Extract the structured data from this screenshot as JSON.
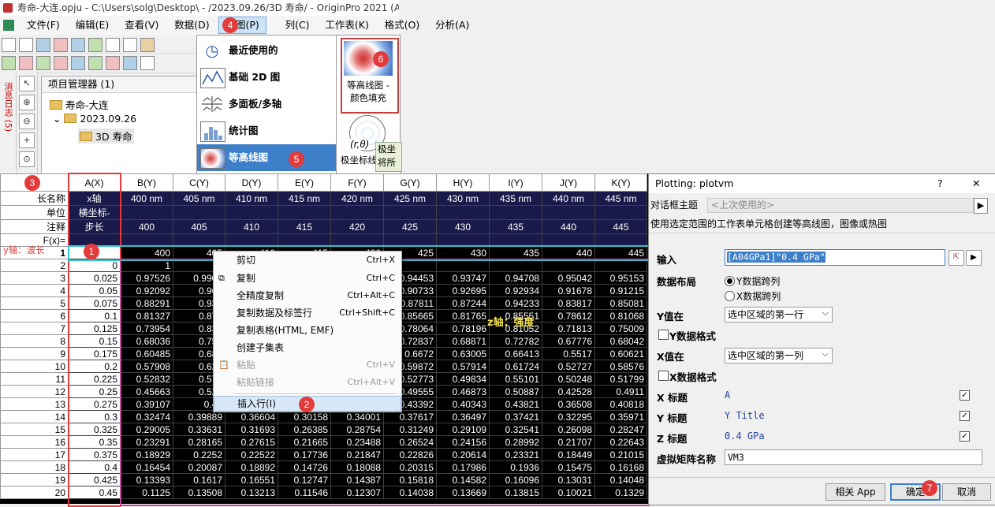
{
  "window": {
    "title": "寿命-大连.opju - C:\\Users\\solg\\Desktop\\ - /2023.09.26/3D 寿命/ - OriginPro 2021 (A"
  },
  "menubar": [
    "文件(F)",
    "编辑(E)",
    "查看(V)",
    "数据(D)",
    "绘图(P)",
    "列(C)",
    "工作表(K)",
    "格式(O)",
    "分析(A)"
  ],
  "side_label": "消息日志 (5)",
  "project_manager": {
    "title": "项目管理器 (1)",
    "root": "寿命-大连",
    "folder": "2023.09.26",
    "subfolder": "3D 寿命"
  },
  "plot_menu": {
    "items": [
      "最近使用的",
      "基础 2D 图",
      "多面板/多轴",
      "统计图",
      "等高线图"
    ],
    "selected": "等高线图",
    "contour_fill_label": "等高线图 - 颜色填充",
    "polar_label": "极坐标线图",
    "polar_formula": "(r,θ)",
    "polar_tip": "极坐 将所"
  },
  "worksheet": {
    "corner_badge": "3",
    "columns": [
      "A(X)",
      "B(Y)",
      "C(Y)",
      "D(Y)",
      "E(Y)",
      "F(Y)",
      "G(Y)",
      "H(Y)",
      "I(Y)",
      "J(Y)",
      "K(Y)"
    ],
    "row_labels": {
      "long_name": "长名称",
      "units": "单位",
      "comments": "注释",
      "fx": "F(x)="
    },
    "long_names": [
      "x轴",
      "400 nm",
      "405 nm",
      "410 nm",
      "415 nm",
      "420 nm",
      "425 nm",
      "430 nm",
      "435 nm",
      "440 nm",
      "445 nm"
    ],
    "units": [
      "横坐标-",
      "",
      "",
      "",
      "",
      "",
      "",
      "",
      "",
      "",
      ""
    ],
    "comments": [
      "步长",
      "400",
      "405",
      "410",
      "415",
      "420",
      "425",
      "430",
      "435",
      "440",
      "445"
    ],
    "y_axis_note": "y轴：波长",
    "z_axis_note": "z轴：强度",
    "rows": [
      {
        "n": "1",
        "cells": [
          "",
          "400",
          "405",
          "410",
          "415",
          "420",
          "425",
          "430",
          "435",
          "440",
          "445"
        ]
      },
      {
        "n": "2",
        "cells": [
          "0",
          "1",
          "",
          "",
          "",
          "",
          "",
          "",
          "",
          "",
          ""
        ]
      },
      {
        "n": "3",
        "cells": [
          "0.025",
          "0.97526",
          "0.9909",
          "",
          "",
          "",
          "0.94453",
          "0.93747",
          "0.94708",
          "0.95042",
          "0.95153"
        ]
      },
      {
        "n": "4",
        "cells": [
          "0.05",
          "0.92092",
          "0.965",
          "",
          "",
          "",
          "0.90733",
          "0.92695",
          "0.92934",
          "0.91678",
          "0.91215"
        ]
      },
      {
        "n": "5",
        "cells": [
          "0.075",
          "0.88291",
          "0.937",
          "",
          "",
          "",
          "0.87811",
          "0.87244",
          "0.94233",
          "0.83817",
          "0.85081"
        ]
      },
      {
        "n": "6",
        "cells": [
          "0.1",
          "0.81327",
          "0.879",
          "",
          "",
          "",
          "0.85665",
          "0.81765",
          "0.85551",
          "0.78612",
          "0.81068"
        ]
      },
      {
        "n": "7",
        "cells": [
          "0.125",
          "0.73954",
          "0.831",
          "",
          "",
          "",
          "0.78064",
          "0.78196",
          "0.81052",
          "0.71813",
          "0.75009"
        ]
      },
      {
        "n": "8",
        "cells": [
          "0.15",
          "0.68036",
          "0.758",
          "",
          "",
          "",
          "0.72837",
          "0.68871",
          "0.72782",
          "0.67776",
          "0.68042"
        ]
      },
      {
        "n": "9",
        "cells": [
          "0.175",
          "0.60485",
          "0.683",
          "",
          "",
          "",
          "0.6672",
          "0.63005",
          "0.66413",
          "0.5517",
          "0.60621"
        ]
      },
      {
        "n": "10",
        "cells": [
          "0.2",
          "0.57908",
          "0.629",
          "",
          "",
          "",
          "0.59872",
          "0.57914",
          "0.61724",
          "0.52727",
          "0.58576"
        ]
      },
      {
        "n": "11",
        "cells": [
          "0.225",
          "0.52832",
          "0.572",
          "",
          "",
          "",
          "0.52773",
          "0.49834",
          "0.55101",
          "0.50248",
          "0.51799"
        ]
      },
      {
        "n": "12",
        "cells": [
          "0.25",
          "0.45663",
          "0.524",
          "",
          "",
          "",
          "0.49555",
          "0.46873",
          "0.50887",
          "0.42528",
          "0.4911"
        ]
      },
      {
        "n": "13",
        "cells": [
          "0.275",
          "0.39107",
          "0.46",
          "",
          "",
          "",
          "0.43392",
          "0.40343",
          "0.43821",
          "0.36508",
          "0.40818"
        ]
      },
      {
        "n": "14",
        "cells": [
          "0.3",
          "0.32474",
          "0.39889",
          "0.36604",
          "0.30158",
          "0.34001",
          "0.37617",
          "0.36497",
          "0.37421",
          "0.32295",
          "0.35971"
        ]
      },
      {
        "n": "15",
        "cells": [
          "0.325",
          "0.29005",
          "0.33631",
          "0.31693",
          "0.26385",
          "0.28754",
          "0.31249",
          "0.29109",
          "0.32541",
          "0.26098",
          "0.28247"
        ]
      },
      {
        "n": "16",
        "cells": [
          "0.35",
          "0.23291",
          "0.28165",
          "0.27615",
          "0.21665",
          "0.23488",
          "0.26524",
          "0.24156",
          "0.28992",
          "0.21707",
          "0.22643"
        ]
      },
      {
        "n": "17",
        "cells": [
          "0.375",
          "0.18929",
          "0.2252",
          "0.22522",
          "0.17736",
          "0.21847",
          "0.22826",
          "0.20614",
          "0.23321",
          "0.18449",
          "0.21015"
        ]
      },
      {
        "n": "18",
        "cells": [
          "0.4",
          "0.16454",
          "0.20087",
          "0.18892",
          "0.14726",
          "0.18088",
          "0.20315",
          "0.17986",
          "0.1936",
          "0.15475",
          "0.16168"
        ]
      },
      {
        "n": "19",
        "cells": [
          "0.425",
          "0.13393",
          "0.1617",
          "0.16551",
          "0.12747",
          "0.14387",
          "0.15818",
          "0.14582",
          "0.16096",
          "0.13031",
          "0.14048"
        ]
      },
      {
        "n": "20",
        "cells": [
          "0.45",
          "0.1125",
          "0.13508",
          "0.13213",
          "0.11546",
          "0.12307",
          "0.14038",
          "0.13669",
          "0.13815",
          "0.10021",
          "0.1329"
        ]
      }
    ]
  },
  "context_menu": {
    "items": [
      {
        "label": "剪切",
        "shortcut": "Ctrl+X"
      },
      {
        "label": "复制",
        "shortcut": "Ctrl+C"
      },
      {
        "label": "全精度复制",
        "shortcut": "Ctrl+Alt+C"
      },
      {
        "label": "复制数据及标签行",
        "shortcut": "Ctrl+Shift+C"
      },
      {
        "label": "复制表格(HTML, EMF)",
        "shortcut": ""
      },
      {
        "label": "创建子集表",
        "shortcut": ""
      },
      {
        "label": "粘贴",
        "shortcut": "Ctrl+V"
      },
      {
        "label": "粘贴链接",
        "shortcut": "Ctrl+Alt+V"
      },
      {
        "label": "插入行(I)",
        "shortcut": ""
      }
    ]
  },
  "dialog": {
    "title": "Plotting: plotvm",
    "help": "?",
    "close": "✕",
    "theme_label": "对话框主题",
    "theme_value": "<上次使用的>",
    "description": "使用选定范围的工作表单元格创建等高线图，图像或热图",
    "input_label": "输入",
    "input_value": "[A04GPa1]\"0.4 GPa\"",
    "layout_label": "数据布局",
    "layout_opt1": "Y数据跨列",
    "layout_opt2": "X数据跨列",
    "y_values_label": "Y值在",
    "y_values_value": "选中区域的第一行",
    "y_format_label": "Y数据格式",
    "x_values_label": "X值在",
    "x_values_value": "选中区域的第一列",
    "x_format_label": "X数据格式",
    "x_title_label": "X 标题",
    "x_title_value": "A",
    "y_title_label": "Y 标题",
    "y_title_value": "Y Title",
    "z_title_label": "Z 标题",
    "z_title_value": "0.4 GPa",
    "vm_label": "虚拟矩阵名称",
    "vm_value": "VM3",
    "btn_app": "相关 App",
    "btn_ok": "确定",
    "btn_cancel": "取消"
  },
  "badges": [
    "1",
    "2",
    "3",
    "4",
    "5",
    "6",
    "7"
  ],
  "colors": {
    "highlight_red": "#e23b3b",
    "row_cyan": "#2ec4d0",
    "range_magenta": "#c04a9a",
    "menu_select": "#3d7fc9"
  }
}
